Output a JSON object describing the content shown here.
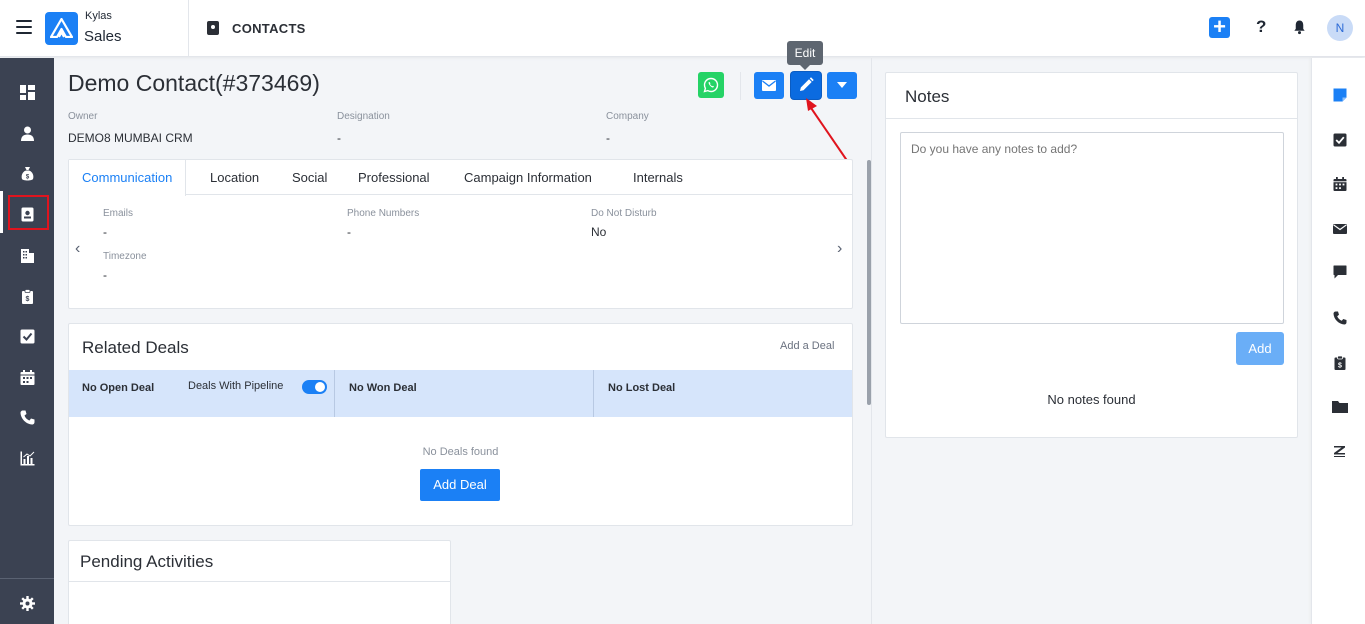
{
  "header": {
    "brand_top": "Kylas",
    "brand_main": "Sales",
    "page_title": "CONTACTS",
    "avatar_initial": "N"
  },
  "left_nav": {
    "items": [
      {
        "name": "dashboard-icon"
      },
      {
        "name": "person-icon"
      },
      {
        "name": "money-bag-icon"
      },
      {
        "name": "contact-card-icon",
        "active": true
      },
      {
        "name": "building-icon"
      },
      {
        "name": "clipboard-dollar-icon"
      },
      {
        "name": "checkbox-icon"
      },
      {
        "name": "calendar-icon"
      },
      {
        "name": "phone-icon"
      },
      {
        "name": "bar-chart-icon"
      }
    ],
    "settings": "gear-icon"
  },
  "contact": {
    "name": "Demo Contact(#373469)",
    "owner_label": "Owner",
    "owner_value": "DEMO8 MUMBAI CRM",
    "designation_label": "Designation",
    "designation_value": "-",
    "company_label": "Company",
    "company_value": "-"
  },
  "actions": {
    "tooltip": "Edit"
  },
  "tabs": [
    "Communication",
    "Location",
    "Social",
    "Professional",
    "Campaign Information",
    "Internals"
  ],
  "communication": {
    "emails_label": "Emails",
    "emails_value": "-",
    "phones_label": "Phone Numbers",
    "phones_value": "-",
    "dnd_label": "Do Not Disturb",
    "dnd_value": "No",
    "timezone_label": "Timezone",
    "timezone_value": "-"
  },
  "related_deals": {
    "title": "Related Deals",
    "add_link": "Add a Deal",
    "open_label": "No Open Deal",
    "pipeline_label": "Deals With Pipeline",
    "pipeline_enabled": true,
    "won_label": "No Won Deal",
    "lost_label": "No Lost Deal",
    "empty_text": "No Deals found",
    "add_button": "Add Deal"
  },
  "pending_activities": {
    "title": "Pending Activities"
  },
  "notes": {
    "title": "Notes",
    "placeholder": "Do you have any notes to add?",
    "add_button": "Add",
    "empty_text": "No notes found"
  },
  "right_nav": {
    "items": [
      "sticky-note-icon",
      "checkbox-icon",
      "calendar-icon",
      "envelope-icon",
      "chat-bubble-icon",
      "phone-icon",
      "clipboard-dollar-icon",
      "folder-icon",
      "zendesk-icon"
    ]
  },
  "colors": {
    "primary": "#1b80f5",
    "whatsapp": "#25d366",
    "sidebar": "#3b4252",
    "highlight": "#e0141e"
  }
}
